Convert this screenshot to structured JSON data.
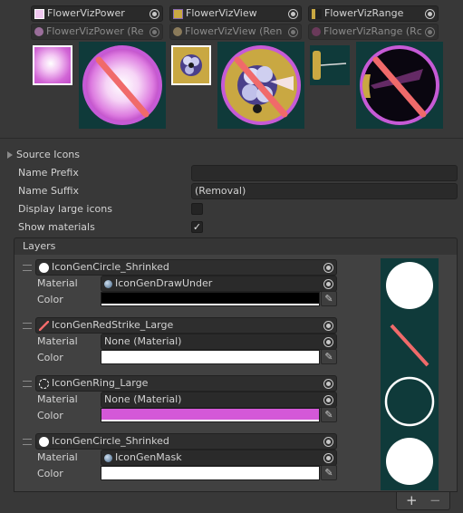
{
  "targets": [
    {
      "name": "FlowerVizPower",
      "removal": "FlowerVizPower (Re"
    },
    {
      "name": "FlowerVizView",
      "removal": "FlowerVizView (Ren"
    },
    {
      "name": "FlowerVizRange",
      "removal": "FlowerVizRange (Rc"
    }
  ],
  "source_icons": {
    "foldout_label": "Source Icons",
    "name_prefix_label": "Name Prefix",
    "name_prefix_value": "",
    "name_suffix_label": "Name Suffix",
    "name_suffix_value": "(Removal)",
    "display_large_icons_label": "Display large icons",
    "display_large_icons_checked": false,
    "show_materials_label": "Show materials",
    "show_materials_checked": true,
    "check_glyph": "✓"
  },
  "layers": {
    "header": "Layers",
    "material_label": "Material",
    "color_label": "Color",
    "items": [
      {
        "name": "IconGenCircle_Shrinked",
        "icon": "white-circle-icon",
        "material": "IconGenDrawUnder",
        "material_icon": "material-sphere-icon",
        "color": "#000000"
      },
      {
        "name": "IconGenRedStrike_Large",
        "icon": "red-strike-icon",
        "material": "None (Material)",
        "material_icon": "",
        "color": "#ffffff"
      },
      {
        "name": "IconGenRing_Large",
        "icon": "ring-icon",
        "material": "None (Material)",
        "material_icon": "",
        "color": "#d458d8"
      },
      {
        "name": "IconGenCircle_Shrinked",
        "icon": "white-circle-icon",
        "material": "IconGenMask",
        "material_icon": "material-sphere-icon",
        "color": "#ffffff"
      }
    ],
    "add_label": "+",
    "remove_label": "−"
  },
  "colors": {
    "preview_bg": "#0f3a3a",
    "strike": "#f06a6a",
    "ring": "#c65ad6"
  }
}
